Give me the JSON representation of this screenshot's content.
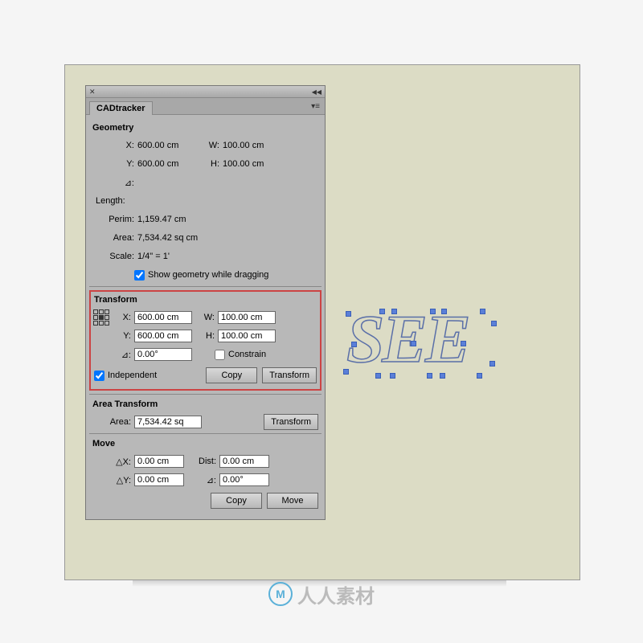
{
  "panel": {
    "tab_title": "CADtracker"
  },
  "geometry": {
    "title": "Geometry",
    "x_label": "X:",
    "x_val": "600.00 cm",
    "y_label": "Y:",
    "y_val": "600.00 cm",
    "w_label": "W:",
    "w_val": "100.00 cm",
    "h_label": "H:",
    "h_val": "100.00 cm",
    "angle_label": "⊿:",
    "length_label": "Length:",
    "perim_label": "Perim:",
    "perim_val": "1,159.47 cm",
    "area_label": "Area:",
    "area_val": "7,534.42 sq cm",
    "scale_label": "Scale:",
    "scale_val": "1/4\" = 1'",
    "show_geom_label": "Show geometry while dragging"
  },
  "transform": {
    "title": "Transform",
    "x_label": "X:",
    "x_val": "600.00 cm",
    "y_label": "Y:",
    "y_val": "600.00 cm",
    "w_label": "W:",
    "w_val": "100.00 cm",
    "h_label": "H:",
    "h_val": "100.00 cm",
    "angle_label": "⊿:",
    "angle_val": "0.00°",
    "constrain_label": "Constrain",
    "independent_label": "Independent",
    "copy_btn": "Copy",
    "transform_btn": "Transform"
  },
  "area_transform": {
    "title": "Area Transform",
    "area_label": "Area:",
    "area_val": "7,534.42 sq",
    "transform_btn": "Transform"
  },
  "move": {
    "title": "Move",
    "dx_label": "△X:",
    "dx_val": "0.00 cm",
    "dy_label": "△Y:",
    "dy_val": "0.00 cm",
    "dist_label": "Dist:",
    "dist_val": "0.00 cm",
    "angle_label": "⊿:",
    "angle_val": "0.00°",
    "copy_btn": "Copy",
    "move_btn": "Move"
  },
  "graphic_text": "SEE",
  "footer_text": "人人素材"
}
